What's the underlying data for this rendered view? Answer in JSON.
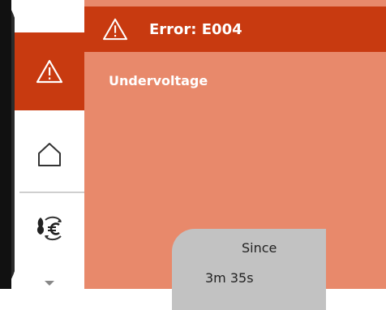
{
  "header": {
    "title": "Error: E004",
    "icon": "warning-icon"
  },
  "error": {
    "message": "Undervoltage"
  },
  "status": {
    "since_label": "Since",
    "since_value": "3m 35s"
  },
  "sidebar": {
    "items": [
      {
        "icon": "warning-icon",
        "active": true
      },
      {
        "icon": "home-icon",
        "active": false
      },
      {
        "icon": "energy-price-icon",
        "active": false
      }
    ],
    "scroll_indicator": "chevron-down-icon"
  },
  "colors": {
    "accent": "#c83a10",
    "panel_background": "#e8896b",
    "status_panel": "#c2c2c2"
  }
}
